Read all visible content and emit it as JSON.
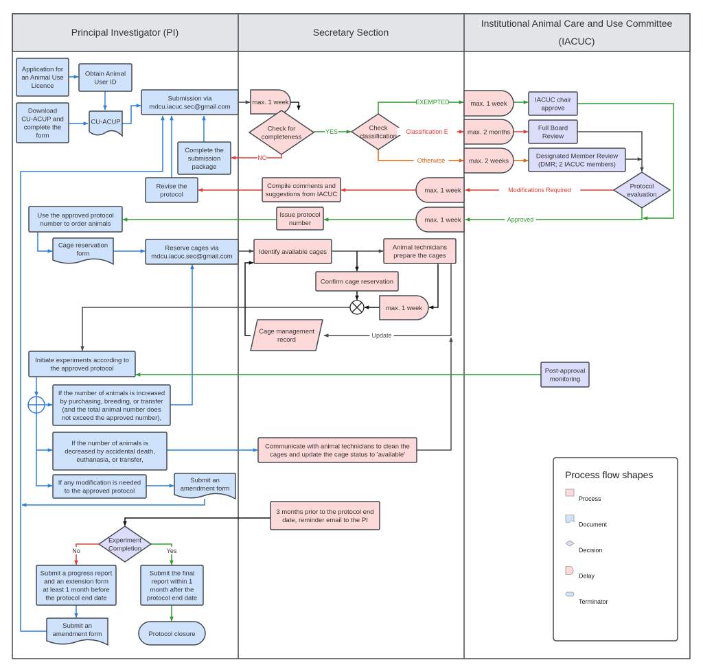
{
  "lanes": [
    {
      "title": [
        "Principal Investigator (PI)"
      ]
    },
    {
      "title": [
        "Secretary Section"
      ]
    },
    {
      "title": [
        "Institutional Animal Care and Use Committee",
        "(IACUC)"
      ]
    }
  ],
  "colors": {
    "pi_fill": "#cfe2fb",
    "secretary_fill": "#fdd9d9",
    "iacuc_fill": "#dcdcfb",
    "header_fill": "#e3e5e8",
    "stroke": "#444a50",
    "blue_flow": "#2a7de1",
    "red_flow": "#e53935",
    "green_flow": "#2e9a2e",
    "orange_flow": "#e0620e",
    "dark_flow": "#444a50"
  },
  "nodes": {
    "application": [
      "Application for",
      "an Animal Use",
      "Licence"
    ],
    "obtain_id": [
      "Obtain Animal",
      "User ID"
    ],
    "download": [
      "Download",
      "CU-ACUP and",
      "complete the",
      "form"
    ],
    "cu_acup": [
      "CU-ACUP"
    ],
    "submission": [
      "Submission via",
      "mdcu.iacuc.sec@gmail.com"
    ],
    "complete_package": [
      "Complete the",
      "submission",
      "package"
    ],
    "revise": [
      "Revise the",
      "protocol"
    ],
    "delay_submit": [
      "max. 1 week"
    ],
    "check_completeness": [
      "Check for",
      "completeness"
    ],
    "check_classification": [
      "Check",
      "classification"
    ],
    "delay_exempted": [
      "max. 1 week"
    ],
    "delay_class_e": [
      "max. 2 months"
    ],
    "delay_otherwise": [
      "max. 2 weeks"
    ],
    "chair_approve": [
      "IACUC chair",
      "approve"
    ],
    "full_board": [
      "Full Board",
      "Review"
    ],
    "dmr": [
      "Designated Member Review",
      "(DMR; 2 IACUC members)"
    ],
    "evaluation": [
      "Protocol",
      "evaluation"
    ],
    "delay_modifications": [
      "max. 1 week"
    ],
    "compile": [
      "Compile comments and",
      "suggestions from IACUC"
    ],
    "delay_approved": [
      "max. 1 week"
    ],
    "issue_number": [
      "Issue protocol",
      "number"
    ],
    "use_approved": [
      "Use the approved protocol",
      "number to order animals"
    ],
    "cage_form": [
      "Cage reservation",
      "form"
    ],
    "reserve_cages": [
      "Reserve cages via",
      "mdcu.iacuc.sec@gmail.com"
    ],
    "identify_cages": [
      "Identify available cages"
    ],
    "technicians_prepare": [
      "Animal technicians",
      "prepare the cages"
    ],
    "confirm_reservation": [
      "Confirm cage reservation"
    ],
    "delay_cages": [
      "max. 1 week"
    ],
    "cage_record": [
      "Cage management",
      "record"
    ],
    "initiate": [
      "Initiate experiments according to",
      "the approved protocol"
    ],
    "increase": [
      "If the number of animals is increased",
      "by purchasing, breeding, or transfer",
      "(and the total animal number does",
      "not exceed the approved number),"
    ],
    "post_approval": [
      "Post-approval",
      "monitoring"
    ],
    "decrease": [
      "If the number of animals is",
      "decreased by accidental death,",
      "euthanasia, or transfer,"
    ],
    "communicate": [
      "Communicate with animal technicians to clean the",
      "cages and update the cage status to 'available'"
    ],
    "modification": [
      "If any modification is needed",
      "to the approved protocol"
    ],
    "amendment_1": [
      "Submit an",
      "amendment form"
    ],
    "reminder": [
      "3 months prior to the protocol end",
      "date, reminder email to the PI"
    ],
    "completion": [
      "Experiment",
      "Completion"
    ],
    "progress_report": [
      "Submit a progress report",
      "and an extension form",
      "at least 1 month before",
      "the protocol end date"
    ],
    "final_report": [
      "Submit the final",
      "report within 1",
      "month after the",
      "protocol end date"
    ],
    "amendment_2": [
      "Submit an",
      "amendment form"
    ],
    "closure": [
      "Protocol closure"
    ]
  },
  "edge_labels": {
    "yes": "YES",
    "no": "NO",
    "exempted": "EXEMPTED",
    "class_e": "Classification E",
    "otherwise": "Otherwise",
    "modifications": "Modifications Required",
    "approved": "Approved",
    "update": "Update",
    "completion_no": "No",
    "completion_yes": "Yes"
  },
  "legend": {
    "title": "Process flow shapes",
    "items": [
      {
        "label": "Process",
        "shape": "process",
        "color": "#fdd9d9"
      },
      {
        "label": "Document",
        "shape": "document",
        "color": "#cfe2fb"
      },
      {
        "label": "Decision",
        "shape": "decision",
        "color": "#dcdcfb"
      },
      {
        "label": "Delay",
        "shape": "delay",
        "color": "#fdd9d9"
      },
      {
        "label": "Terminator",
        "shape": "terminator",
        "color": "#cfe2fb"
      }
    ]
  }
}
